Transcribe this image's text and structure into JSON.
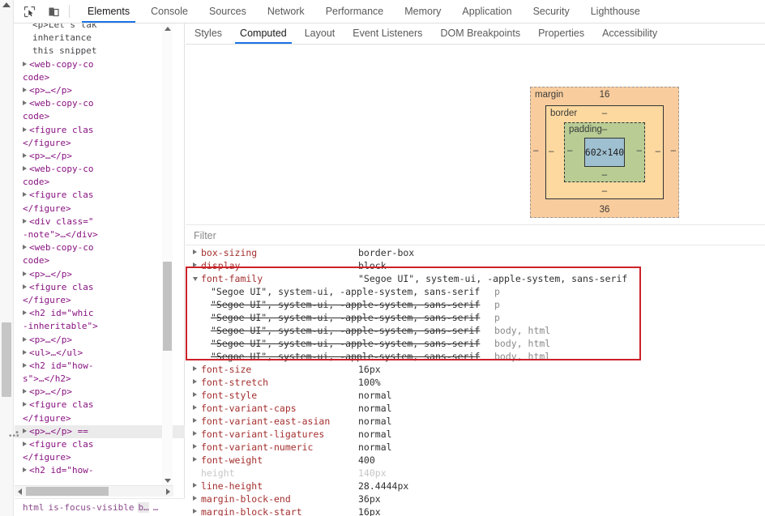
{
  "toolbar": {
    "inspect_icon": "inspect-element-icon",
    "device_icon": "device-toolbar-icon",
    "tabs": [
      {
        "label": "Elements",
        "active": true
      },
      {
        "label": "Console",
        "active": false
      },
      {
        "label": "Sources",
        "active": false
      },
      {
        "label": "Network",
        "active": false
      },
      {
        "label": "Performance",
        "active": false
      },
      {
        "label": "Memory",
        "active": false
      },
      {
        "label": "Application",
        "active": false
      },
      {
        "label": "Security",
        "active": false
      },
      {
        "label": "Lighthouse",
        "active": false
      }
    ]
  },
  "sidebar_tabs": [
    {
      "label": "Styles",
      "active": false
    },
    {
      "label": "Computed",
      "active": true
    },
    {
      "label": "Layout",
      "active": false
    },
    {
      "label": "Event Listeners",
      "active": false
    },
    {
      "label": "DOM Breakpoints",
      "active": false
    },
    {
      "label": "Properties",
      "active": false
    },
    {
      "label": "Accessibility",
      "active": false
    }
  ],
  "dom_tree": {
    "rows": [
      {
        "text": "<p>Let's tak",
        "clipped": true
      },
      {
        "text": "inheritance ",
        "clipped": true
      },
      {
        "text": "this snippet",
        "clipped": true
      },
      {
        "text": "<web-copy-co",
        "triangle": "closed",
        "clipped": true
      },
      {
        "text": "code>",
        "continuation": true
      },
      {
        "text": "<p>…</p>",
        "triangle": "closed"
      },
      {
        "text": "<web-copy-co",
        "triangle": "closed",
        "clipped": true
      },
      {
        "text": "code>",
        "continuation": true
      },
      {
        "text": "<figure clas",
        "triangle": "closed",
        "clipped": true
      },
      {
        "text": "</figure>",
        "continuation": true
      },
      {
        "text": "<p>…</p>",
        "triangle": "closed"
      },
      {
        "text": "<web-copy-co",
        "triangle": "closed",
        "clipped": true
      },
      {
        "text": "code>",
        "continuation": true
      },
      {
        "text": "<figure clas",
        "triangle": "closed",
        "clipped": true
      },
      {
        "text": "</figure>",
        "continuation": true
      },
      {
        "text": "<div class=\"",
        "triangle": "closed",
        "clipped": true
      },
      {
        "text": "-note\">…</div>",
        "continuation": true
      },
      {
        "text": "<web-copy-co",
        "triangle": "closed",
        "clipped": true
      },
      {
        "text": "code>",
        "continuation": true
      },
      {
        "text": "<p>…</p>",
        "triangle": "closed"
      },
      {
        "text": "<figure clas",
        "triangle": "closed",
        "clipped": true
      },
      {
        "text": "</figure>",
        "continuation": true
      },
      {
        "text": "<h2 id=\"whic",
        "triangle": "closed",
        "clipped": true
      },
      {
        "text": "-inheritable\">",
        "continuation": true
      },
      {
        "text": "<p>…</p>",
        "triangle": "closed"
      },
      {
        "text": "<ul>…</ul>",
        "triangle": "closed"
      },
      {
        "text": "<h2 id=\"how-",
        "triangle": "closed",
        "clipped": true
      },
      {
        "text": "s\">…</h2>",
        "continuation": true
      },
      {
        "text": "<p>…</p>",
        "triangle": "closed"
      },
      {
        "text": "<figure clas",
        "triangle": "closed",
        "clipped": true
      },
      {
        "text": "</figure>",
        "continuation": true
      },
      {
        "text": "<p>…</p> == ",
        "triangle": "closed",
        "selected": true,
        "clipped": true
      },
      {
        "text": "<figure clas",
        "triangle": "closed",
        "clipped": true
      },
      {
        "text": "</figure>",
        "continuation": true
      },
      {
        "text": "<h2 id=\"how-",
        "triangle": "closed",
        "clipped": true
      }
    ],
    "overflow_menu": "•••"
  },
  "breadcrumbs": [
    "html",
    "is-focus-visible",
    "b…",
    "…"
  ],
  "box_model": {
    "margin_label": "margin",
    "margin_top": "16",
    "margin_right": "–",
    "margin_bottom": "36",
    "margin_left": "–",
    "border_label": "border",
    "border_top": "–",
    "border_right": "–",
    "border_bottom": "–",
    "border_left": "–",
    "padding_label": "padding",
    "padding_top": "–",
    "padding_right": "–",
    "padding_bottom": "–",
    "padding_left": "–",
    "content_size": "602×140",
    "colors": {
      "margin": "#f9cc9d",
      "border": "#fdd9a0",
      "padding": "#b8cc94",
      "content": "#9fc0d0"
    }
  },
  "filter": {
    "placeholder": "Filter",
    "value": ""
  },
  "highlight_color": "#cc2229",
  "computed_properties": [
    {
      "name": "box-sizing",
      "value": "border-box",
      "expanded": false,
      "inherited": false
    },
    {
      "name": "display",
      "value": "block",
      "expanded": false,
      "inherited": false
    },
    {
      "name": "font-family",
      "value": "\"Segoe UI\", system-ui, -apple-system, sans-serif",
      "expanded": true,
      "inherited": false,
      "trace": [
        {
          "value": "\"Segoe UI\", system-ui, -apple-system, sans-serif",
          "selector": "p",
          "struck": false
        },
        {
          "value": "\"Segoe UI\", system-ui, -apple-system, sans-serif",
          "selector": "p",
          "struck": true
        },
        {
          "value": "\"Segoe UI\", system-ui, -apple-system, sans-serif",
          "selector": "p",
          "struck": true
        },
        {
          "value": "\"Segoe UI\", system-ui, -apple-system, sans-serif",
          "selector": "body, html",
          "struck": true
        },
        {
          "value": "\"Segoe UI\", system-ui, -apple-system, sans-serif",
          "selector": "body, html",
          "struck": true
        },
        {
          "value": "\"Segoe UI\", system-ui, -apple-system, sans-serif",
          "selector": "body, html",
          "struck": true
        }
      ]
    },
    {
      "name": "font-size",
      "value": "16px",
      "expanded": false,
      "inherited": false
    },
    {
      "name": "font-stretch",
      "value": "100%",
      "expanded": false,
      "inherited": false
    },
    {
      "name": "font-style",
      "value": "normal",
      "expanded": false,
      "inherited": false
    },
    {
      "name": "font-variant-caps",
      "value": "normal",
      "expanded": false,
      "inherited": false
    },
    {
      "name": "font-variant-east-asian",
      "value": "normal",
      "expanded": false,
      "inherited": false
    },
    {
      "name": "font-variant-ligatures",
      "value": "normal",
      "expanded": false,
      "inherited": false
    },
    {
      "name": "font-variant-numeric",
      "value": "normal",
      "expanded": false,
      "inherited": false
    },
    {
      "name": "font-weight",
      "value": "400",
      "expanded": false,
      "inherited": false
    },
    {
      "name": "height",
      "value": "140px",
      "expanded": null,
      "inherited": true
    },
    {
      "name": "line-height",
      "value": "28.4444px",
      "expanded": false,
      "inherited": false
    },
    {
      "name": "margin-block-end",
      "value": "36px",
      "expanded": false,
      "inherited": false
    },
    {
      "name": "margin-block-start",
      "value": "16px",
      "expanded": false,
      "inherited": false
    }
  ]
}
